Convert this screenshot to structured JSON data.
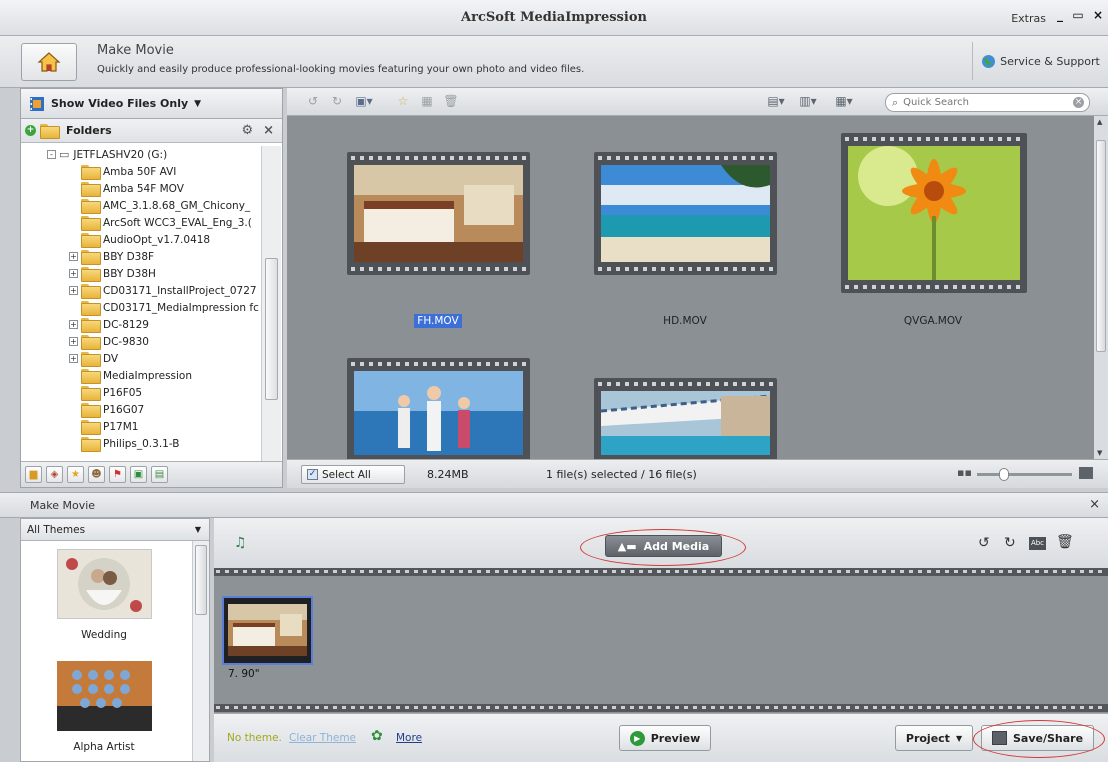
{
  "window": {
    "title": "ArcSoft MediaImpression",
    "extras": "Extras"
  },
  "header": {
    "title": "Make Movie",
    "subtitle": "Quickly and easily produce professional-looking movies featuring your own photo and video files.",
    "service": "Service & Support"
  },
  "left_pane": {
    "filter_label": "Show Video Files Only",
    "folders_label": "Folders",
    "tree": [
      {
        "label": "JETFLASHV20 (G:)",
        "level": 0,
        "expander": "-",
        "type": "drive"
      },
      {
        "label": "Amba 50F AVI",
        "level": 1,
        "expander": "",
        "type": "folder"
      },
      {
        "label": "Amba 54F MOV",
        "level": 1,
        "expander": "",
        "type": "folder"
      },
      {
        "label": "AMC_3.1.8.68_GM_Chicony_",
        "level": 1,
        "expander": "",
        "type": "folder"
      },
      {
        "label": "ArcSoft WCC3_EVAL_Eng_3.(",
        "level": 1,
        "expander": "",
        "type": "folder"
      },
      {
        "label": "AudioOpt_v1.7.0418",
        "level": 1,
        "expander": "",
        "type": "folder"
      },
      {
        "label": "BBY D38F",
        "level": 1,
        "expander": "+",
        "type": "folder"
      },
      {
        "label": "BBY D38H",
        "level": 1,
        "expander": "+",
        "type": "folder"
      },
      {
        "label": "CD03171_InstallProject_0727",
        "level": 1,
        "expander": "+",
        "type": "folder"
      },
      {
        "label": "CD03171_MediaImpression fc",
        "level": 1,
        "expander": "",
        "type": "folder"
      },
      {
        "label": "DC-8129",
        "level": 1,
        "expander": "+",
        "type": "folder"
      },
      {
        "label": "DC-9830",
        "level": 1,
        "expander": "+",
        "type": "folder"
      },
      {
        "label": "DV",
        "level": 1,
        "expander": "+",
        "type": "folder"
      },
      {
        "label": "MediaImpression",
        "level": 1,
        "expander": "",
        "type": "folder"
      },
      {
        "label": "P16F05",
        "level": 1,
        "expander": "",
        "type": "folder"
      },
      {
        "label": "P16G07",
        "level": 1,
        "expander": "",
        "type": "folder"
      },
      {
        "label": "P17M1",
        "level": 1,
        "expander": "",
        "type": "folder"
      },
      {
        "label": "Philips_0.3.1-B",
        "level": 1,
        "expander": "",
        "type": "folder"
      }
    ]
  },
  "browser": {
    "search_placeholder": "Quick Search",
    "files": [
      {
        "name": "FH.MOV",
        "selected": true
      },
      {
        "name": "HD.MOV",
        "selected": false
      },
      {
        "name": "QVGA.MOV",
        "selected": false
      },
      {
        "name": "",
        "selected": false
      },
      {
        "name": "",
        "selected": false
      }
    ],
    "select_all": "Select All",
    "size": "8.24MB",
    "selection_status": "1 file(s) selected / 16 file(s)"
  },
  "make_movie": {
    "panel_title": "Make Movie",
    "theme_filter": "All Themes",
    "themes": [
      "Wedding",
      "Alpha Artist"
    ],
    "add_media": "Add Media",
    "clip_duration": "7. 90\"",
    "no_theme": "No theme.",
    "clear_theme": "Clear Theme",
    "more": "More",
    "preview": "Preview",
    "project": "Project",
    "save_share": "Save/Share"
  },
  "colors": {
    "accent_red": "#d23a36",
    "selection_blue": "#3d6fd8",
    "preview_green": "#2f9a3c"
  }
}
